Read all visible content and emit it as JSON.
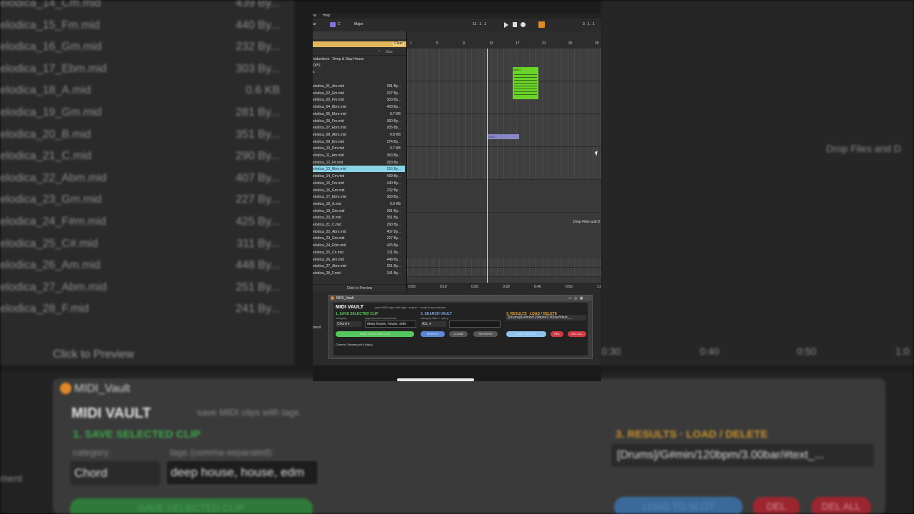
{
  "background": {
    "files": [
      {
        "name": "elodica_14_Cm.mid",
        "size": "439 By..."
      },
      {
        "name": "elodica_15_Fm.mid",
        "size": "440 By..."
      },
      {
        "name": "elodica_16_Gm.mid",
        "size": "232 By..."
      },
      {
        "name": "elodica_17_Ebm.mid",
        "size": "303 By..."
      },
      {
        "name": "elodica_18_A.mid",
        "size": "0.6 KB"
      },
      {
        "name": "elodica_19_Gm.mid",
        "size": "281 By..."
      },
      {
        "name": "elodica_20_B.mid",
        "size": "351 By..."
      },
      {
        "name": "elodica_21_C.mid",
        "size": "290 By..."
      },
      {
        "name": "elodica_22_Abm.mid",
        "size": "407 By..."
      },
      {
        "name": "elodica_23_Gm.mid",
        "size": "227 By..."
      },
      {
        "name": "elodica_24_F#m.mid",
        "size": "425 By..."
      },
      {
        "name": "elodica_25_C#.mid",
        "size": "311 By..."
      },
      {
        "name": "elodica_26_Am.mid",
        "size": "448 By..."
      },
      {
        "name": "elodica_27_Abm.mid",
        "size": "251 By..."
      },
      {
        "name": "elodica_28_F.mid",
        "size": "241 By..."
      }
    ],
    "click_to_preview": "Click to Preview",
    "drop_files": "Drop Files and D",
    "ruler": [
      "0:30",
      "0:40",
      "0:50",
      "1:0"
    ],
    "device_title": "MIDI_Vault",
    "vault_title": "MIDI VAULT",
    "vault_sub": "save MIDI clips with tags",
    "save_header": "1. SAVE SELECTED CLIP",
    "category_label": "category:",
    "tags_label": "tags (comma-separated):",
    "category_value": "Chord",
    "tags_value": "deep house, house, edm",
    "save_button": "SAVE SELECTED CLIP",
    "results_header": "3. RESULTS  ·  LOAD / DELETE",
    "results_value": "[Drums]/G#min/120bpm/3.00bar/#text_...",
    "load_button": "LOAD TO SLOT",
    "del_button": "DEL",
    "delall_button": "DEL ALL",
    "ment": "ment"
  },
  "screen": {
    "menu": {
      "left": "ns",
      "help": "Help"
    },
    "transport": {
      "scale_left": "ar",
      "key": "C",
      "scale": "Major",
      "position": "11 .  1 .  1",
      "loop_pos": "3 .  1 .  1"
    },
    "browser": {
      "clear": "Clear",
      "col_name": "^",
      "col_size": "Size",
      "path1": "roductions - Deep & Slap House",
      "path2": "OPS",
      "path3": "s",
      "files": [
        {
          "name": "elodica_01_Am.mid",
          "size": "281 By..."
        },
        {
          "name": "elodica_02_Em.mid",
          "size": "327 By..."
        },
        {
          "name": "elodica_03_Fm.mid",
          "size": "303 By..."
        },
        {
          "name": "elodica_04_Bbm.mid",
          "size": "400 By..."
        },
        {
          "name": "elodica_05_Ebm.mid",
          "size": "0.7 KB"
        },
        {
          "name": "elodica_06_Fm.mid",
          "size": "360 By..."
        },
        {
          "name": "elodica_07_Ebm.mid",
          "size": "205 By..."
        },
        {
          "name": "elodica_08_Abm.mid",
          "size": "0.8 KB"
        },
        {
          "name": "elodica_09_Em.mid",
          "size": "274 By..."
        },
        {
          "name": "elodica_10_Dm.mid",
          "size": "0.7 KB"
        },
        {
          "name": "elodica_11_Am.mid",
          "size": "363 By..."
        },
        {
          "name": "elodica_12_F#.mid",
          "size": "263 By..."
        },
        {
          "name": "elodica_13_Bbm.mid",
          "size": "216 By..."
        },
        {
          "name": "elodica_14_Cm.mid",
          "size": "439 By..."
        },
        {
          "name": "elodica_15_Fm.mid",
          "size": "440 By..."
        },
        {
          "name": "elodica_16_Gm.mid",
          "size": "232 By..."
        },
        {
          "name": "elodica_17_Ebm.mid",
          "size": "303 By..."
        },
        {
          "name": "elodica_18_A.mid",
          "size": "0.6 KB"
        },
        {
          "name": "elodica_19_Gm.mid",
          "size": "281 By..."
        },
        {
          "name": "elodica_20_B.mid",
          "size": "351 By..."
        },
        {
          "name": "elodica_21_C.mid",
          "size": "290 By..."
        },
        {
          "name": "elodica_22_Abm.mid",
          "size": "407 By..."
        },
        {
          "name": "elodica_23_Gm.mid",
          "size": "227 By..."
        },
        {
          "name": "elodica_24_F#m.mid",
          "size": "425 By..."
        },
        {
          "name": "elodica_25_C#.mid",
          "size": "311 By..."
        },
        {
          "name": "elodica_26_Am.mid",
          "size": "448 By..."
        },
        {
          "name": "elodica_27_Abm.mid",
          "size": "251 By..."
        },
        {
          "name": "elodica_28_F.mid",
          "size": "241 By..."
        }
      ],
      "selected_index": 12,
      "preview": "Click to Preview"
    },
    "arrangement": {
      "bars": [
        "1",
        "5",
        "9",
        "13",
        "17",
        "21",
        "25",
        "29"
      ],
      "clip_green": "MIDI 1",
      "clip_blue": "MIDI 1",
      "drop": "Drop Files and D",
      "times": [
        "0:00",
        "0:10",
        "0:20",
        "0:30",
        "0:40",
        "0:50",
        "1:0"
      ]
    },
    "device": {
      "ment": "ment",
      "title": "MIDI_Vault",
      "vault_title": "MIDI VAULT",
      "vault_sub": "save MIDI clips with tags  ·  search  ·  recall in any session",
      "save_header": "1. SAVE SELECTED CLIP",
      "search_header": "2. SEARCH VAULT",
      "results_header": "3. RESULTS  ·  LOAD / DELETE",
      "category_label": "category:",
      "tags_label": "tags (comma-separated):",
      "filter_label": "category filter + query:",
      "category_value": "Chord",
      "tags_value": "deep house, house, edm",
      "filter_value": "ALL",
      "results_value": "[Drums]/G#min/120bpm/3.00bar/#text_...",
      "save_button": "SAVE SELECTED CLIP",
      "search_button": "SEARCH",
      "clear_button": "CLEAR",
      "refresh_button": "REFRESH",
      "load_button": "LOAD TO SLOT",
      "del_button": "DEL",
      "delall_button": "DEL ALL",
      "status": "Cleared. Showing all 6 clip(s)."
    }
  }
}
